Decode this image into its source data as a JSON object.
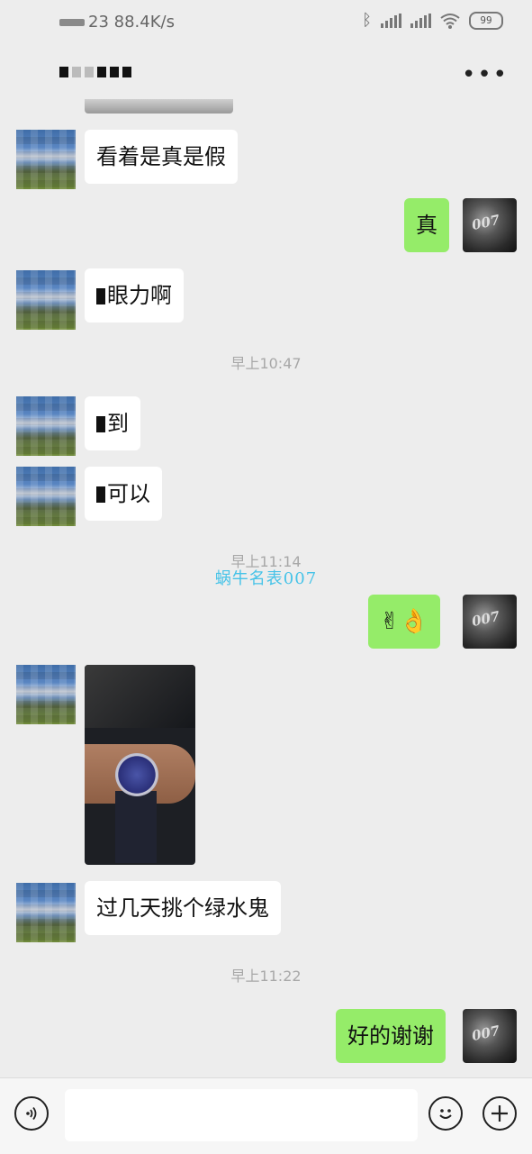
{
  "status_bar": {
    "network_speed": "23 88.4K/s",
    "battery": "99",
    "icons": [
      "bluetooth-icon",
      "signal-icon",
      "signal-icon",
      "wifi-icon",
      "battery-icon"
    ]
  },
  "header": {
    "title": "",
    "more_icon": "more-icon"
  },
  "messages": [
    {
      "side": "left",
      "text": "看着是真是假"
    },
    {
      "side": "right",
      "text": "真"
    },
    {
      "side": "left",
      "text": "眼力啊"
    },
    {
      "time": "早上10:47"
    },
    {
      "side": "left",
      "text": "到"
    },
    {
      "side": "left",
      "text": "可以"
    },
    {
      "time": "早上11:14"
    },
    {
      "side": "right",
      "text": "✌👌"
    },
    {
      "side": "left",
      "type": "image"
    },
    {
      "side": "left",
      "text": "过几天挑个绿水鬼"
    },
    {
      "time": "早上11:22"
    },
    {
      "side": "right",
      "text": "好的谢谢"
    }
  ],
  "watermark": "蜗牛名表007",
  "avatar_text": "007",
  "input_bar": {
    "placeholder": "",
    "icons": [
      "voice-icon",
      "emoji-icon",
      "plus-icon"
    ]
  }
}
